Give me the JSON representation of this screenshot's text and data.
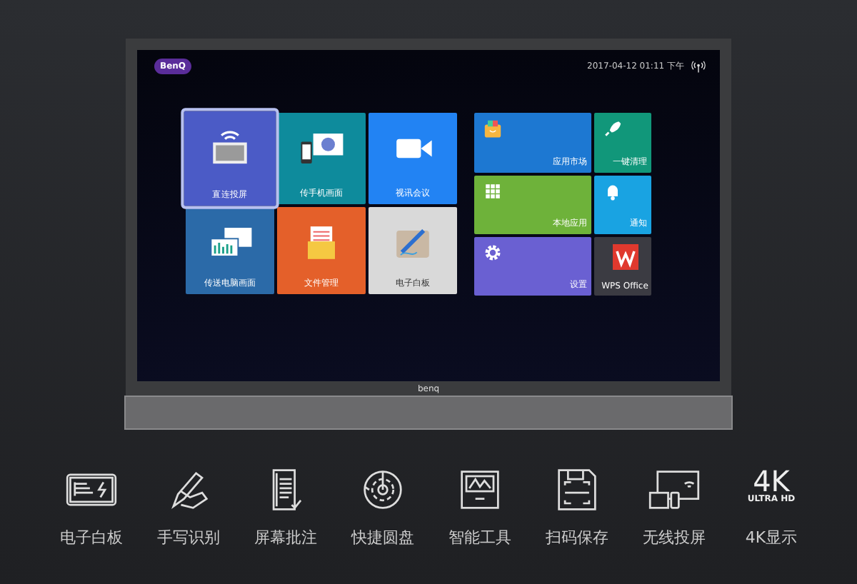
{
  "screen": {
    "logo": "BenQ",
    "datetime": "2017-04-12 01:11 下午",
    "left_tiles": [
      {
        "label": "直连投屏",
        "kind": "cast",
        "color": "#4b5bc6",
        "selected": true
      },
      {
        "label": "传手机画面",
        "kind": "phone",
        "color": "#0e8b9c",
        "selected": false
      },
      {
        "label": "视讯会议",
        "kind": "video",
        "color": "#2283f3",
        "selected": false
      },
      {
        "label": "传送电脑画面",
        "kind": "laptop",
        "color": "#2b6aa8",
        "selected": false
      },
      {
        "label": "文件管理",
        "kind": "folder",
        "color": "#e4602a",
        "selected": false
      },
      {
        "label": "电子白板",
        "kind": "pen",
        "color": "#d9d9d9",
        "selected": false
      }
    ],
    "right_tiles": [
      {
        "label": "应用市场",
        "kind": "bag",
        "color": "#1d78d2",
        "selected": false
      },
      {
        "label": "一键清理",
        "kind": "rocket",
        "color": "#11977a",
        "selected": false
      },
      {
        "label": "本地应用",
        "kind": "grid",
        "color": "#6eb23a",
        "selected": false
      },
      {
        "label": "通知",
        "kind": "bell",
        "color": "#19a3e2",
        "selected": false
      },
      {
        "label": "设置",
        "kind": "gear",
        "color": "#6a60d2",
        "selected": false
      },
      {
        "label": "WPS Office",
        "kind": "wps",
        "color": "#3b3b42",
        "selected": false
      }
    ]
  },
  "bezel": {
    "brand": "benq"
  },
  "features": [
    {
      "label": "电子白板",
      "kind": "board"
    },
    {
      "label": "手写识别",
      "kind": "hand"
    },
    {
      "label": "屏幕批注",
      "kind": "doc"
    },
    {
      "label": "快捷圆盘",
      "kind": "dial"
    },
    {
      "label": "智能工具",
      "kind": "tools"
    },
    {
      "label": "扫码保存",
      "kind": "disk"
    },
    {
      "label": "无线投屏",
      "kind": "wireless"
    },
    {
      "label": "4K显示",
      "kind": "uhd",
      "big": "4K",
      "small": "ULTRA HD"
    }
  ]
}
